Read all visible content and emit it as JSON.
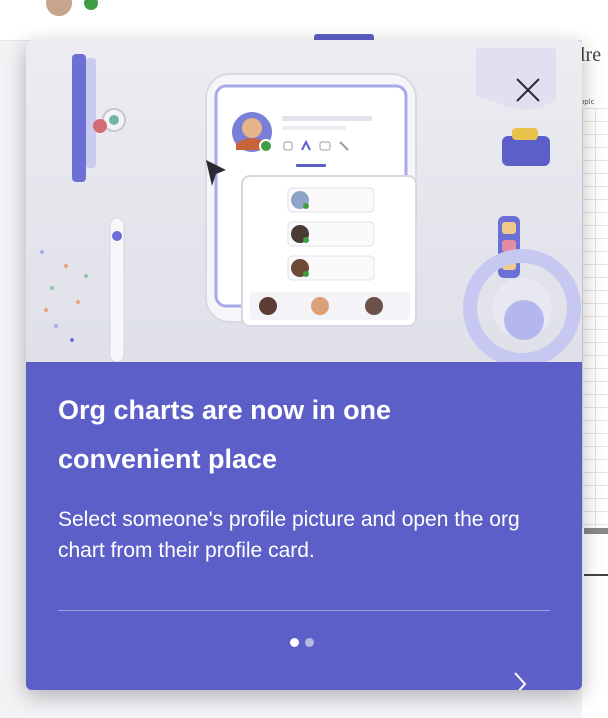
{
  "background": {
    "right_title": "nlre",
    "right_small_text": "oplc"
  },
  "dialog": {
    "title": "Org charts are now in one convenient place",
    "description": "Select someone's profile picture and open the org chart from their profile card.",
    "page_count": 2,
    "current_page": 1,
    "close_icon": "close-icon",
    "next_icon": "chevron-right-icon"
  },
  "colors": {
    "accent": "#5b5fc7",
    "text_on_accent": "#ffffff",
    "presence_available": "#3f9d44"
  }
}
